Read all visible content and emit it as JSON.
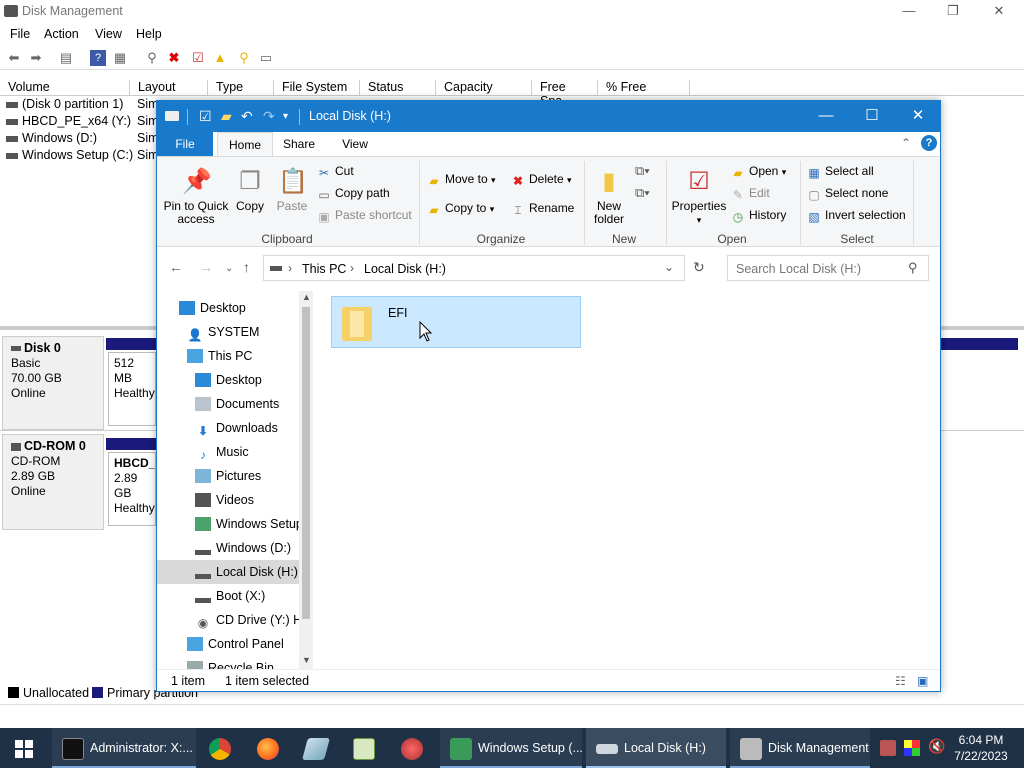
{
  "dm": {
    "title": "Disk Management",
    "menu": [
      "File",
      "Action",
      "View",
      "Help"
    ],
    "columns": [
      "Volume",
      "Layout",
      "Type",
      "File System",
      "Status",
      "Capacity",
      "Free Spa...",
      "% Free"
    ],
    "volumes": [
      {
        "name": "(Disk 0 partition 1)",
        "layout": "Sim"
      },
      {
        "name": "HBCD_PE_x64 (Y:)",
        "layout": "Sim"
      },
      {
        "name": "Windows (D:)",
        "layout": "Sim"
      },
      {
        "name": "Windows Setup (C:)",
        "layout": "Sim"
      }
    ],
    "disks": [
      {
        "name": "Disk 0",
        "type": "Basic",
        "size": "70.00 GB",
        "status": "Online",
        "part_line1": "512 MB",
        "part_line2": "Healthy"
      },
      {
        "name": "CD-ROM 0",
        "type": "CD-ROM",
        "size": "2.89 GB",
        "status": "Online",
        "part_line1": "HBCD_I",
        "part_line2": "2.89 GB",
        "part_line3": "Healthy"
      }
    ],
    "legend": {
      "unallocated": "Unallocated",
      "primary": "Primary partition",
      "unallocated_color": "#000000",
      "primary_color": "#1a1a7a"
    }
  },
  "explorer": {
    "title": "Local Disk (H:)",
    "tabs": {
      "file": "File",
      "home": "Home",
      "share": "Share",
      "view": "View"
    },
    "ribbon": {
      "pin_line1": "Pin to Quick",
      "pin_line2": "access",
      "copy": "Copy",
      "paste": "Paste",
      "cut": "Cut",
      "copy_path": "Copy path",
      "paste_shortcut": "Paste shortcut",
      "clipboard": "Clipboard",
      "move_to": "Move to",
      "copy_to": "Copy to",
      "delete": "Delete",
      "rename": "Rename",
      "organize": "Organize",
      "new_folder_line1": "New",
      "new_folder_line2": "folder",
      "new": "New",
      "properties": "Properties",
      "open_btn": "Open",
      "edit": "Edit",
      "history": "History",
      "open": "Open",
      "select_all": "Select all",
      "select_none": "Select none",
      "invert_selection": "Invert selection",
      "select": "Select"
    },
    "address": {
      "crumb1": "This PC",
      "crumb2": "Local Disk (H:)",
      "search_placeholder": "Search Local Disk (H:)"
    },
    "nav": [
      "Desktop",
      "SYSTEM",
      "This PC",
      "Desktop",
      "Documents",
      "Downloads",
      "Music",
      "Pictures",
      "Videos",
      "Windows Setup",
      "Windows (D:)",
      "Local Disk (H:)",
      "Boot (X:)",
      "CD Drive (Y:) H",
      "Control Panel",
      "Recycle Bin"
    ],
    "items": [
      {
        "name": "EFI"
      }
    ],
    "status": {
      "count": "1 item",
      "selected": "1 item selected"
    },
    "accent": "#1979ca"
  },
  "taskbar": {
    "items": [
      "Administrator: X:...",
      "Windows Setup (...",
      "Local Disk (H:)",
      "Disk Management"
    ],
    "time": "6:04 PM",
    "date": "7/22/2023"
  }
}
